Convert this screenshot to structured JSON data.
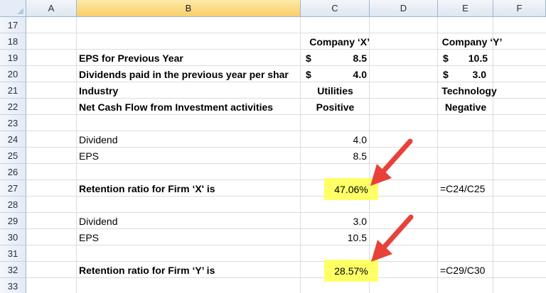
{
  "columns": [
    "A",
    "B",
    "C",
    "D",
    "E",
    "F"
  ],
  "rows": [
    "17",
    "18",
    "19",
    "20",
    "21",
    "22",
    "23",
    "24",
    "25",
    "26",
    "27",
    "28",
    "29",
    "30",
    "31",
    "32",
    "33"
  ],
  "company_x_header": "Company ‘X’",
  "company_y_header": "Company ‘Y’",
  "eps_prev_label": "EPS for Previous Year",
  "dividends_prev_label": "Dividends paid in the previous year per shar",
  "industry_label": "Industry",
  "net_cash_flow_label": "Net Cash Flow from Investment activities",
  "currency_symbol": "$",
  "x_eps_prev": "8.5",
  "x_dividend_prev": "4.0",
  "x_industry": "Utilities",
  "x_net_cash_flow": "Positive",
  "y_eps_prev": "10.5",
  "y_dividend_prev": "3.0",
  "y_industry": "Technology",
  "y_net_cash_flow": "Negative",
  "dividend_label": "Dividend",
  "eps_label": "EPS",
  "x_dividend": "4.0",
  "x_eps": "8.5",
  "retention_x_label": "Retention ratio for Firm ‘X' is",
  "retention_x_value": "47.06%",
  "retention_x_formula": "=C24/C25",
  "y_dividend": "3.0",
  "y_eps": "10.5",
  "retention_y_label": "Retention ratio for Firm ‘Y’ is",
  "retention_y_value": "28.57%",
  "retention_y_formula": "=C29/C30",
  "colors": {
    "highlight": "#ffff66",
    "arrow": "#e8413a",
    "selected_column": "#f8cf68",
    "header": "#e4ecf7"
  }
}
